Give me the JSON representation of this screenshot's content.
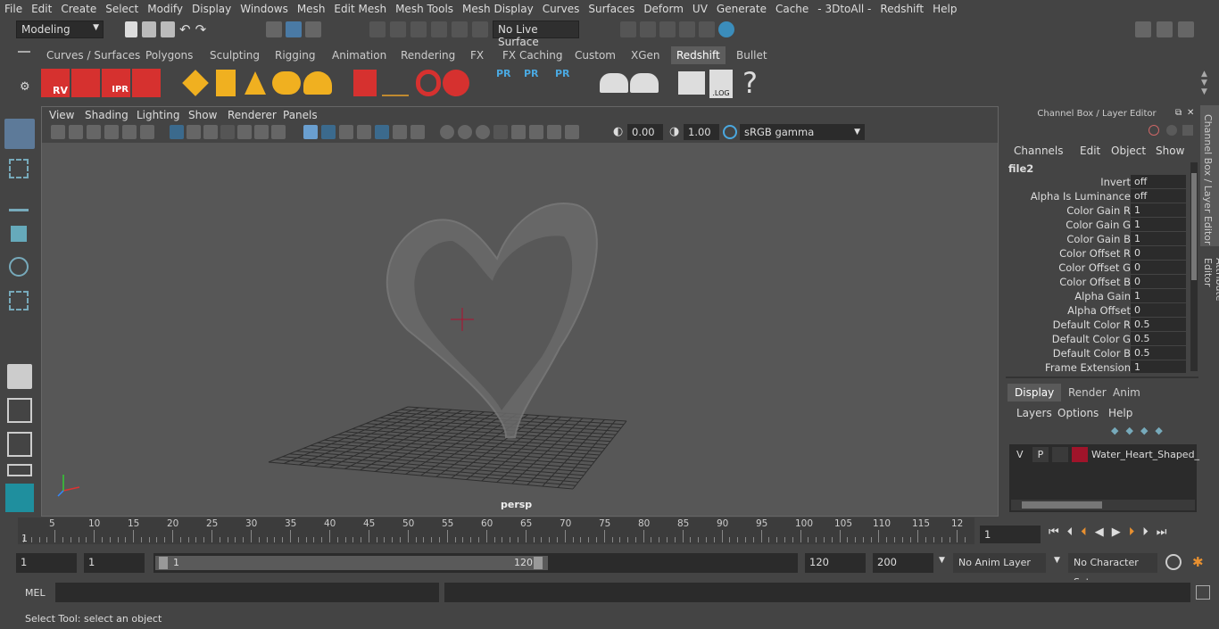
{
  "menubar": {
    "items": [
      "File",
      "Edit",
      "Create",
      "Select",
      "Modify",
      "Display",
      "Windows",
      "Mesh",
      "Edit Mesh",
      "Mesh Tools",
      "Mesh Display",
      "Curves",
      "Surfaces",
      "Deform",
      "UV",
      "Generate",
      "Cache",
      "- 3DtoAll -",
      "Redshift",
      "Help"
    ]
  },
  "status": {
    "mode": "Modeling",
    "live_surface": "No Live Surface"
  },
  "shelf": {
    "tabs": [
      "Curves / Surfaces",
      "Polygons",
      "Sculpting",
      "Rigging",
      "Animation",
      "Rendering",
      "FX",
      "FX Caching",
      "Custom",
      "XGen",
      "Redshift",
      "Bullet"
    ],
    "active": "Redshift",
    "labels": {
      "rv": "RV",
      "ipr": "IPR",
      "pr1": "PR",
      "pr2": "PR",
      "pr3": "PR",
      "log": ".LOG",
      "help": "?"
    }
  },
  "viewport": {
    "menus": [
      "View",
      "Shading",
      "Lighting",
      "Show",
      "Renderer",
      "Panels"
    ],
    "exposure": "0.00",
    "gamma": "1.00",
    "colorspace": "sRGB gamma",
    "camera": "persp"
  },
  "channelbox": {
    "title": "Channel Box / Layer Editor",
    "menus": [
      "Channels",
      "Edit",
      "Object",
      "Show"
    ],
    "node": "file2",
    "attrs": [
      {
        "label": "Invert",
        "value": "off"
      },
      {
        "label": "Alpha Is Luminance",
        "value": "off"
      },
      {
        "label": "Color Gain R",
        "value": "1"
      },
      {
        "label": "Color Gain G",
        "value": "1"
      },
      {
        "label": "Color Gain B",
        "value": "1"
      },
      {
        "label": "Color Offset R",
        "value": "0"
      },
      {
        "label": "Color Offset G",
        "value": "0"
      },
      {
        "label": "Color Offset B",
        "value": "0"
      },
      {
        "label": "Alpha Gain",
        "value": "1"
      },
      {
        "label": "Alpha Offset",
        "value": "0"
      },
      {
        "label": "Default Color R",
        "value": "0.5"
      },
      {
        "label": "Default Color G",
        "value": "0.5"
      },
      {
        "label": "Default Color B",
        "value": "0.5"
      },
      {
        "label": "Frame Extension",
        "value": "1"
      }
    ],
    "layer_tabs": [
      "Display",
      "Render",
      "Anim"
    ],
    "layer_menus": [
      "Layers",
      "Options",
      "Help"
    ],
    "layer": {
      "v": "V",
      "p": "P",
      "name": "Water_Heart_Shaped_",
      "color": "#a0142a"
    }
  },
  "sidetabs": {
    "channel": "Channel Box / Layer Editor",
    "attr": "Attribute Editor"
  },
  "timeline": {
    "ticks": [
      "5",
      "10",
      "15",
      "20",
      "25",
      "30",
      "35",
      "40",
      "45",
      "50",
      "55",
      "60",
      "65",
      "70",
      "75",
      "80",
      "85",
      "90",
      "95",
      "100",
      "105",
      "110",
      "115",
      "12"
    ],
    "start_mark": "1",
    "current": "1"
  },
  "range": {
    "start": "1",
    "inner_start": "1",
    "slider_start": "1",
    "slider_end": "120",
    "end": "120",
    "max": "200",
    "anim_layer": "No Anim Layer",
    "char_set": "No Character Set"
  },
  "cmd": {
    "label": "MEL"
  },
  "help": {
    "text": "Select Tool: select an object"
  }
}
